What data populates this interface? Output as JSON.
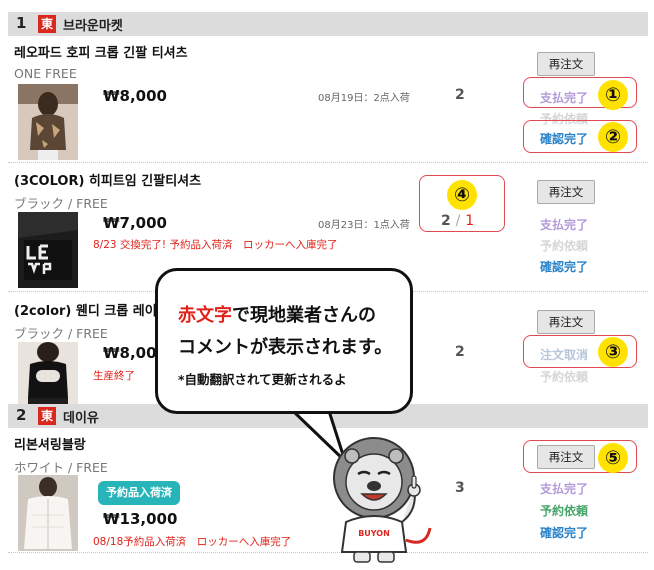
{
  "shops": [
    {
      "number": "1",
      "badge": "東",
      "name": "브라운마켓"
    },
    {
      "number": "2",
      "badge": "東",
      "name": "데이유"
    }
  ],
  "items": [
    {
      "name": "레오파드 호피 크롭 긴팔 티셔츠",
      "option": "ONE FREE",
      "price": "₩8,000",
      "date": "08月19日：2点入荷",
      "qty": "2",
      "reorder": "再注文",
      "statuses": [
        "支払完了",
        "予約依頼",
        "確認完了"
      ]
    },
    {
      "name": "(3COLOR) 히피트임 긴팔티셔츠",
      "option": "ブラック / FREE",
      "price": "₩7,000",
      "date": "08月23日：1点入荷",
      "qty": "2",
      "qty_sep": "/",
      "qty_sub": "1",
      "message": "8/23 交換完了! 予約品入荷済　ロッカーへ入庫完了",
      "reorder": "再注文",
      "statuses": [
        "支払完了",
        "予約依頼",
        "確認完了"
      ]
    },
    {
      "name": "(2color) 웬디 크롭 레이",
      "option": "ブラック / FREE",
      "price": "₩8,000",
      "qty": "2",
      "message": "生産終了",
      "reorder": "再注文",
      "statuses": [
        "注文取消",
        "予約依頼"
      ]
    },
    {
      "name": "리본셔링블랑",
      "option": "ホワイト / FREE",
      "badge": "予約品入荷済",
      "price": "₩13,000",
      "qty": "3",
      "message": "08/18予約品入荷済　ロッカーへ入庫完了",
      "reorder": "再注文",
      "statuses": [
        "支払完了",
        "予約依頼",
        "確認完了"
      ]
    }
  ],
  "callouts": [
    "①",
    "②",
    "③",
    "④",
    "⑤"
  ],
  "bubble": {
    "red_text": "赤文字",
    "line1_rest": "で現地業者さんの",
    "line2": "コメントが表示されます。",
    "note": "*自動翻訳されて更新されるよ"
  },
  "mascot_shirt": "BUYON",
  "colors": {
    "shop_badge": "#d9281f",
    "highlight": "#e04a55",
    "callout": "#ffe200",
    "red_message": "#e0221a",
    "paid": "#b49ad8",
    "confirmed": "#2a82c8",
    "requested_active": "#46a66a",
    "preorder_badge": "#27b5ba"
  }
}
